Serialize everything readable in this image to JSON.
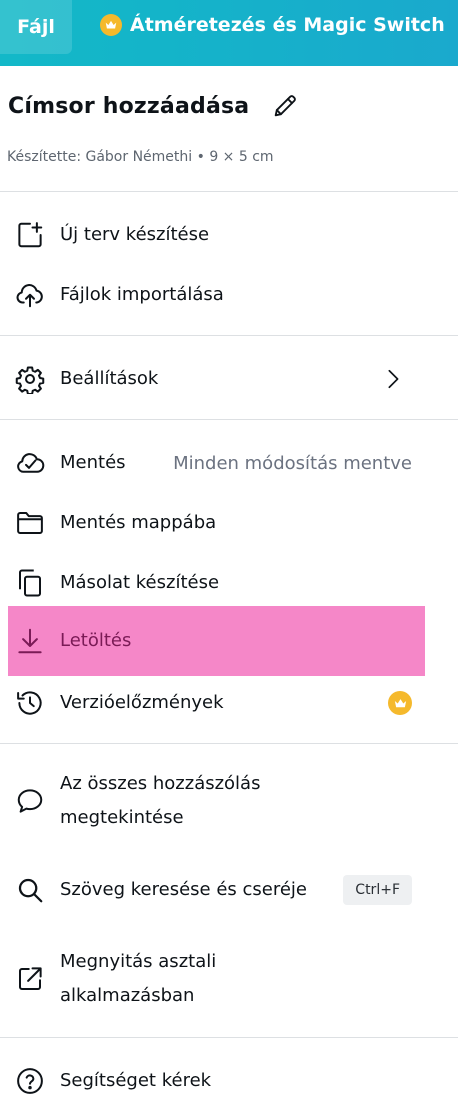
{
  "header": {
    "file_tab": "Fájl",
    "resize_label": "Átméretezés és Magic Switch",
    "accent": "#14b4c9",
    "premium_color": "#f5b92c"
  },
  "design": {
    "title": "Címsor hozzáadása",
    "meta": "Készítette: Gábor Némethi • 9 × 5 cm"
  },
  "menu": {
    "new_design": "Új terv készítése",
    "import_files": "Fájlok importálása",
    "settings": "Beállítások",
    "save": "Mentés",
    "save_status": "Minden módosítás mentve",
    "save_to_folder": "Mentés mappába",
    "make_copy": "Másolat készítése",
    "download": "Letöltés",
    "version_history": "Verzióelőzmények",
    "view_comments": "Az összes hozzászólás megtekintése",
    "find_replace": "Szöveg keresése és cseréje",
    "find_replace_shortcut": "Ctrl+F",
    "open_desktop": "Megnyitás asztali alkalmazásban",
    "help": "Segítséget kérek"
  },
  "highlight_color": "#f587c8"
}
